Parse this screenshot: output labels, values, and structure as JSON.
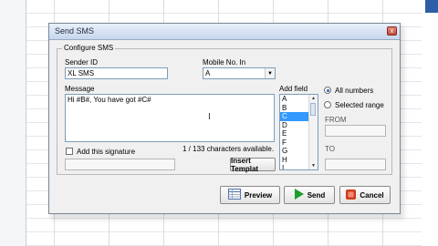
{
  "dialog": {
    "title": "Send SMS",
    "close_symbol": "x",
    "group_label": "Configure SMS"
  },
  "sender": {
    "label": "Sender ID",
    "value": "XL SMS"
  },
  "mobile": {
    "label": "Mobile No. In",
    "value": "A"
  },
  "message": {
    "label": "Message",
    "value": "Hi  #B#, You have got  #C#"
  },
  "add_field": {
    "label": "Add field",
    "items": [
      "A",
      "B",
      "C",
      "D",
      "E",
      "F",
      "G",
      "H",
      "I"
    ],
    "selected": "C"
  },
  "range": {
    "all_numbers": "All numbers",
    "selected_range": "Selected range",
    "from_label": "FROM",
    "to_label": "TO",
    "from_value": "",
    "to_value": ""
  },
  "signature": {
    "label": "Add this signature",
    "value": ""
  },
  "chars": "1 / 133 characters available.",
  "buttons": {
    "insert_template": "Insert Templat",
    "preview": "Preview",
    "send": "Send",
    "cancel": "Cancel"
  },
  "icons": {
    "preview": "sheet-icon",
    "send": "play-icon",
    "cancel": "cancel-icon"
  },
  "colors": {
    "accent": "#3399ff",
    "send_green": "#1f9e2a",
    "cancel_red": "#d03a1f"
  }
}
